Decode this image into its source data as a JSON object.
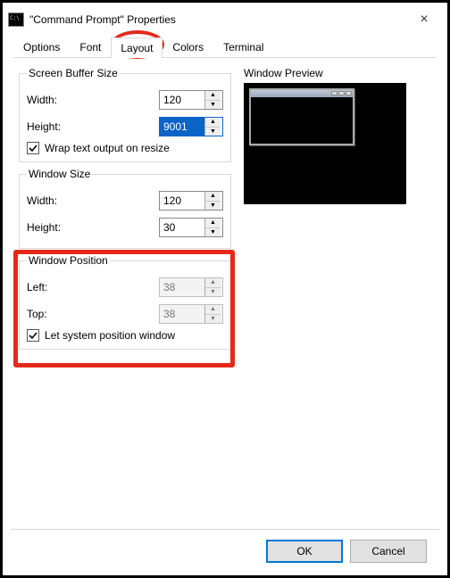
{
  "titlebar": {
    "title": "\"Command Prompt\" Properties",
    "close": "×"
  },
  "tabs": {
    "options": "Options",
    "font": "Font",
    "layout": "Layout",
    "colors": "Colors",
    "terminal": "Terminal"
  },
  "screenBuffer": {
    "legend": "Screen Buffer Size",
    "widthLabel": "Width:",
    "widthValue": "120",
    "heightLabel": "Height:",
    "heightValue": "9001",
    "wrapLabel": "Wrap text output on resize",
    "wrapChecked": true
  },
  "windowSize": {
    "legend": "Window Size",
    "widthLabel": "Width:",
    "widthValue": "120",
    "heightLabel": "Height:",
    "heightValue": "30"
  },
  "windowPosition": {
    "legend": "Window Position",
    "leftLabel": "Left:",
    "leftValue": "38",
    "topLabel": "Top:",
    "topValue": "38",
    "letSystemLabel": "Let system position window",
    "letSystemChecked": true
  },
  "preview": {
    "label": "Window Preview"
  },
  "buttons": {
    "ok": "OK",
    "cancel": "Cancel"
  },
  "glyphs": {
    "up": "▲",
    "down": "▼"
  }
}
